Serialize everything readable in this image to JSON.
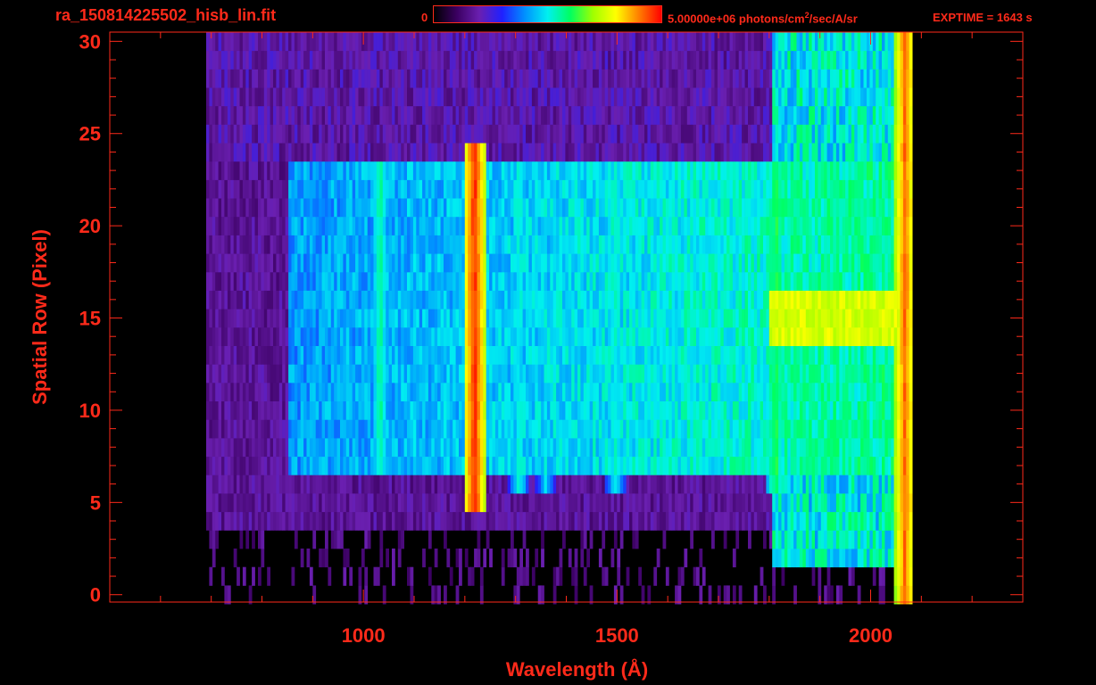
{
  "header": {
    "filename": "ra_150814225502_hisb_lin.fit",
    "colorbar_min": "0",
    "colorbar_max_prefix": "5.00000e+06 photons/cm",
    "colorbar_max_sup": "2",
    "colorbar_max_suffix": "/sec/A/sr",
    "exptime": "EXPTIME = 1643 s"
  },
  "colors": {
    "axis": "#ff2a1a",
    "background": "#000000",
    "colormap": [
      "#000000",
      "#3a0060",
      "#6a1fb0",
      "#2020ff",
      "#0090ff",
      "#00f0f0",
      "#00ff60",
      "#a0ff00",
      "#ffff00",
      "#ff8000",
      "#ff0000"
    ]
  },
  "chart_data": {
    "type": "heatmap",
    "xlabel": "Wavelength (Å)",
    "ylabel": "Spatial Row (Pixel)",
    "xlim": [
      500,
      2300
    ],
    "ylim": [
      -0.4,
      30.5
    ],
    "x_ticks": [
      1000,
      1500,
      2000
    ],
    "x_tick_labels": [
      "1000",
      "1500",
      "2000"
    ],
    "y_ticks": [
      0,
      5,
      10,
      15,
      20,
      25,
      30
    ],
    "y_tick_labels": [
      "0",
      "5",
      "10",
      "15",
      "20",
      "25",
      "30"
    ],
    "x_minor_step": 100,
    "y_minor_step": 1,
    "colorbar_range": [
      0,
      5000000
    ],
    "colorbar_unit": "photons/cm^2/sec/A/sr",
    "data_extent_x": [
      690,
      2080
    ],
    "rows": 31,
    "emission_features": [
      {
        "wavelength": 1216,
        "rows": [
          5,
          24
        ],
        "level": 0.95
      },
      {
        "wavelength": 1030,
        "rows": [
          7,
          23
        ],
        "level": 0.55
      },
      {
        "wavelength": 1304,
        "rows": [
          6,
          23
        ],
        "level": 0.5
      },
      {
        "wavelength": 1356,
        "rows": [
          6,
          23
        ],
        "level": 0.45
      },
      {
        "wavelength": 1495,
        "rows": [
          6,
          23
        ],
        "level": 0.5
      },
      {
        "wavelength": 1810,
        "rows": [
          6,
          23
        ],
        "level": 0.6
      },
      {
        "wavelength": 2065,
        "rows": [
          0,
          30
        ],
        "level": 0.9
      }
    ],
    "bright_band": {
      "rows": [
        14,
        16
      ],
      "x": [
        1800,
        2060
      ],
      "level": 0.72
    },
    "continuum_region": {
      "rows": [
        7,
        23
      ],
      "x": [
        850,
        2060
      ],
      "level": 0.35
    }
  }
}
